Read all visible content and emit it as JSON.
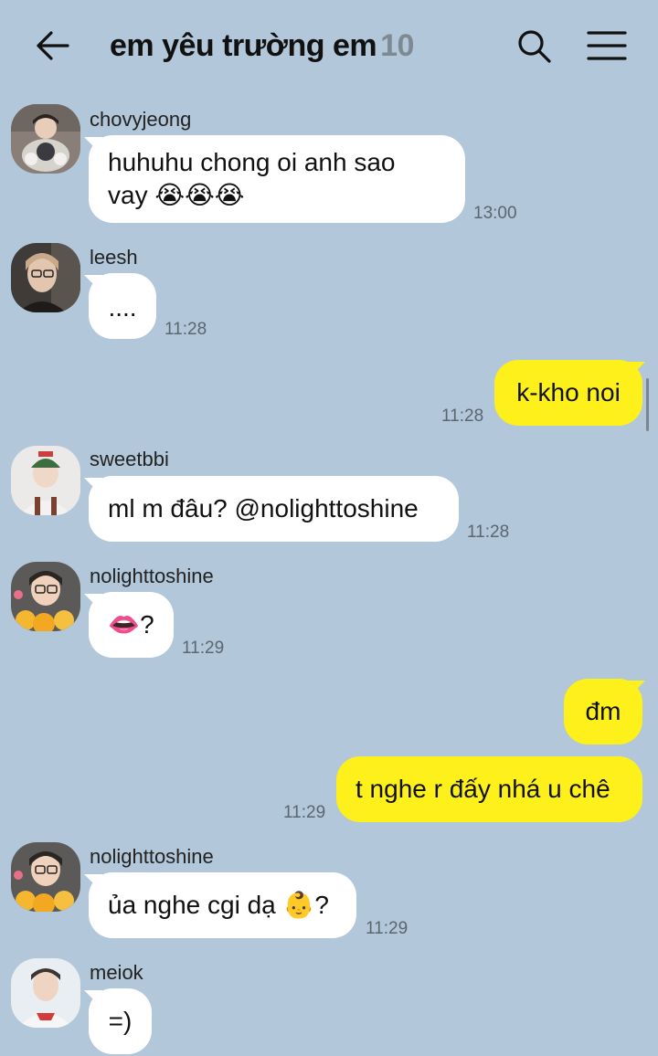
{
  "header": {
    "title": "em yêu trường em",
    "member_count": "10"
  },
  "messages": [
    {
      "sender": "chovyjeong",
      "line1": "huhuhu chong oi anh sao",
      "line2": "vay 😭😭😭",
      "time": "13:00"
    },
    {
      "sender": "leesh",
      "text": "....",
      "time": "11:28"
    },
    {
      "mine": true,
      "text": "k-kho noi",
      "time": "11:28"
    },
    {
      "sender": "sweetbbi",
      "text": "ml m đâu? @nolighttoshine",
      "time": "11:28"
    },
    {
      "sender": "nolighttoshine",
      "text": "👄?",
      "time": "11:29"
    },
    {
      "mine": true,
      "text": "đm"
    },
    {
      "mine": true,
      "text": "t nghe r đấy nhá u chê",
      "time": "11:29"
    },
    {
      "sender": "nolighttoshine",
      "text": "ủa nghe cgi dạ 👶?",
      "time": "11:29"
    },
    {
      "sender": "meiok",
      "text": "=)"
    }
  ],
  "colors": {
    "background": "#b2c7d9",
    "incoming_bubble": "#ffffff",
    "outgoing_bubble": "#fef01b"
  },
  "icons": {
    "back": "arrow-left-icon",
    "search": "search-icon",
    "menu": "hamburger-menu-icon"
  }
}
